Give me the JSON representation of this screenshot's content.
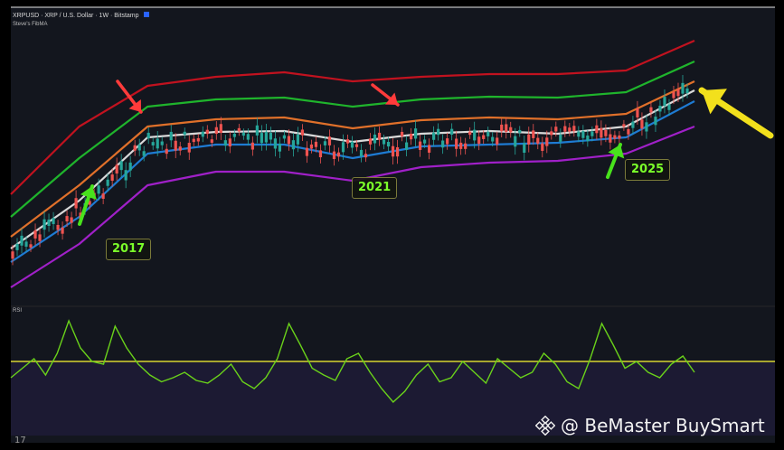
{
  "header": {
    "symbol_line": "XRPUSD · XRP / U.S. Dollar · 1W · Bitstamp",
    "indicator_name": "Steve's FibMA",
    "accent_color": "#2962ff"
  },
  "rsi_label": "RSI",
  "annotations": {
    "year_2017": "2017",
    "year_2021": "2021",
    "year_2025": "2025"
  },
  "watermark": {
    "text": "@ BeMaster BuySmart",
    "icon": "binance-diamond-icon"
  },
  "footer_logo": "17",
  "colors": {
    "background": "#13161e",
    "rsi_background": "#1c1a33",
    "band_red": "#c1121f",
    "band_green": "#1fb42c",
    "band_orange": "#e0702a",
    "band_white": "#d9d9d9",
    "band_blue": "#1e7bd3",
    "band_purple": "#a020c8",
    "candle_up": "#26a69a",
    "candle_down": "#ef5350",
    "rsi_line": "#6ad21a",
    "rsi_level": "#d8d430",
    "arrow_red": "#ff3b3b",
    "arrow_green": "#48e21c",
    "arrow_yellow": "#f2e01c"
  },
  "chart_data": {
    "type": "line",
    "title": "XRPUSD · XRP / U.S. Dollar · 1W · Bitstamp",
    "xlabel": "",
    "ylabel": "",
    "grid": false,
    "x": [
      0,
      10,
      20,
      30,
      40,
      50,
      60,
      70,
      80,
      90,
      100
    ],
    "series": [
      {
        "color": "#c1121f",
        "values": [
          215,
          140,
          95,
          85,
          80,
          90,
          85,
          82,
          82,
          78,
          45
        ]
      },
      {
        "color": "#1fb42c",
        "values": [
          240,
          175,
          118,
          110,
          108,
          118,
          110,
          107,
          108,
          102,
          68
        ]
      },
      {
        "color": "#e0702a",
        "values": [
          262,
          205,
          140,
          132,
          130,
          142,
          133,
          130,
          132,
          126,
          90
        ]
      },
      {
        "color": "#d9d9d9",
        "values": [
          275,
          222,
          152,
          146,
          145,
          157,
          148,
          145,
          148,
          140,
          100
        ]
      },
      {
        "color": "#1e7bd3",
        "values": [
          290,
          240,
          170,
          160,
          160,
          175,
          162,
          160,
          158,
          152,
          112
        ]
      },
      {
        "color": "#a020c8",
        "values": [
          318,
          270,
          205,
          190,
          190,
          200,
          185,
          180,
          178,
          170,
          140
        ]
      }
    ],
    "rsi": {
      "level": 70,
      "values": [
        48,
        55,
        62,
        50,
        66,
        90,
        70,
        60,
        58,
        86,
        70,
        58,
        50,
        45,
        48,
        52,
        46,
        44,
        50,
        58,
        45,
        40,
        48,
        62,
        88,
        72,
        55,
        50,
        46,
        62,
        66,
        52,
        40,
        30,
        38,
        50,
        58,
        45,
        48,
        60,
        52,
        44,
        62,
        55,
        48,
        52,
        66,
        58,
        45,
        40,
        62,
        88,
        72,
        55,
        60,
        52,
        48,
        58,
        64,
        52
      ]
    }
  }
}
